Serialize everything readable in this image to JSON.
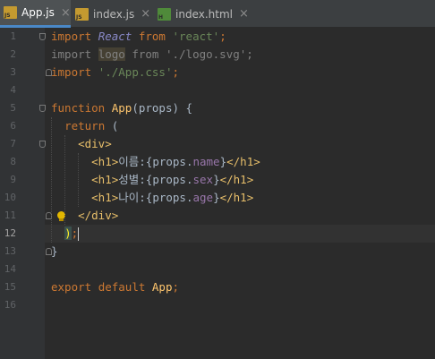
{
  "tabs": [
    {
      "label": "App.js",
      "type": "JS"
    },
    {
      "label": "index.js",
      "type": "JS"
    },
    {
      "label": "index.html",
      "type": "H"
    }
  ],
  "tab_close_glyph": "×",
  "line_numbers": [
    "1",
    "2",
    "3",
    "4",
    "5",
    "6",
    "7",
    "8",
    "9",
    "10",
    "11",
    "12",
    "13",
    "14",
    "15",
    "16"
  ],
  "code": {
    "l1": {
      "kw1": "import",
      "cls": "React",
      "kw2": "from",
      "str": "'react'",
      "semi": ";"
    },
    "l2": {
      "kw1": "import",
      "id": "logo",
      "kw2": "from",
      "str": "'./logo.svg'",
      "semi": ";"
    },
    "l3": {
      "kw1": "import",
      "str": "'./App.css'",
      "semi": ";"
    },
    "l5": {
      "kw": "function",
      "fn": "App",
      "rest": "(props) {"
    },
    "l6": {
      "kw": "return",
      "rest": " ("
    },
    "l7": {
      "tag": "<div>"
    },
    "l8": {
      "open": "<h1>",
      "text": "이름:{props.",
      "prop": "name",
      "close_brace": "}",
      "close": "</h1>"
    },
    "l9": {
      "open": "<h1>",
      "text": "성별:{props.",
      "prop": "sex",
      "close_brace": "}",
      "close": "</h1>"
    },
    "l10": {
      "open": "<h1>",
      "text": "나이:{props.",
      "prop": "age",
      "close_brace": "}",
      "close": "</h1>"
    },
    "l11": {
      "tag": "</div>"
    },
    "l12": {
      "paren": ")",
      "semi": ";"
    },
    "l13": {
      "brace": "}"
    },
    "l15": {
      "kw1": "export",
      "kw2": "default",
      "fn": "App",
      "semi": ";"
    }
  }
}
